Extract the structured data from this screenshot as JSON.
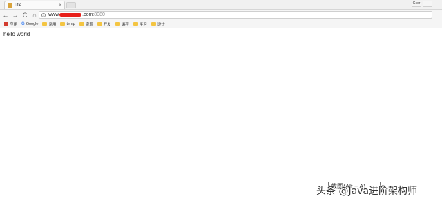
{
  "browser": {
    "tab": {
      "title": "Title",
      "close": "×"
    },
    "window_buttons": [
      "Gcor",
      "—"
    ],
    "nav": {
      "back": "←",
      "forward": "→",
      "reload": "C",
      "home": "⌂"
    },
    "address": {
      "prefix": "www",
      "suffix": ".com",
      "port": ":8080"
    },
    "bookmarks": [
      {
        "label": "应用",
        "icon": "apps-icon"
      },
      {
        "label": "Google",
        "icon": "google-icon"
      },
      {
        "label": "常用",
        "icon": "folder-icon"
      },
      {
        "label": "temp",
        "icon": "folder-icon"
      },
      {
        "label": "资源",
        "icon": "folder-icon"
      },
      {
        "label": "开发",
        "icon": "folder-icon"
      },
      {
        "label": "编程",
        "icon": "folder-icon"
      },
      {
        "label": "学习",
        "icon": "folder-icon"
      },
      {
        "label": "设计",
        "icon": "folder-icon"
      }
    ]
  },
  "page": {
    "text": "hello world"
  },
  "overlay": {
    "tooltip": "截图(Alt + A)",
    "caret": "∨",
    "watermark": "头条 @Java进阶架构师"
  }
}
